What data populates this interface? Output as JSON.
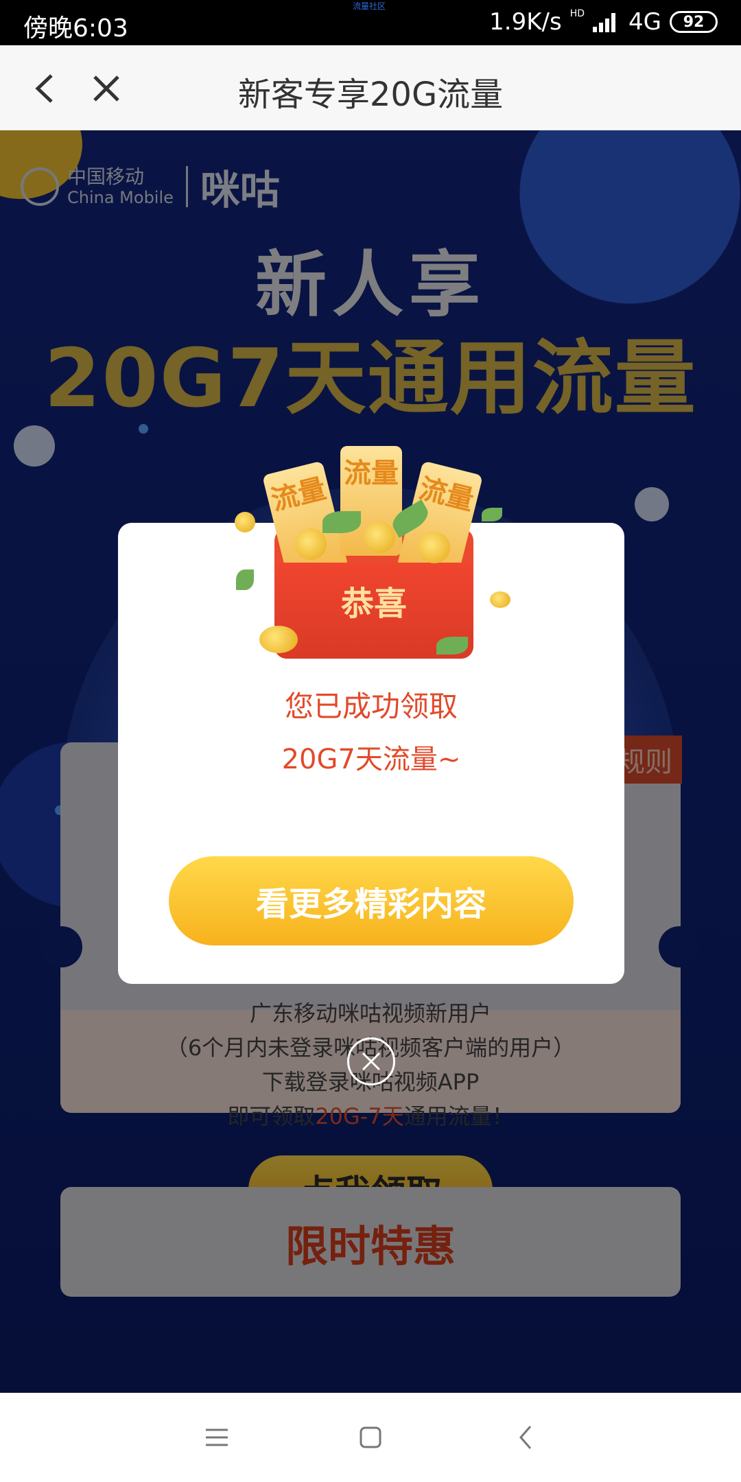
{
  "status_bar": {
    "time": "傍晚6:03",
    "speed": "1.9K/s",
    "network": "4G",
    "battery": "92",
    "hd": "HD"
  },
  "watermark": "流量社区",
  "header": {
    "title": "新客专享20G流量"
  },
  "page": {
    "logo": {
      "cn": "中国移动",
      "en": "China Mobile",
      "brand": "咪咕"
    },
    "hero": {
      "line1": "新人享",
      "line2": "20G7天通用流量"
    },
    "card": {
      "tag": "规则",
      "lines": [
        "广东移动咪咕视频新用户",
        "（6个月内未登录咪咕视频客户端的用户）",
        "下载登录咪咕视频APP"
      ],
      "line4_prefix": "即可领取",
      "line4_highlight": "20G-7天",
      "line4_suffix": "通用流量！",
      "claim_button": "点我领取"
    },
    "card2": {
      "title": "限时特惠"
    }
  },
  "modal": {
    "envelope": {
      "label": "恭喜",
      "ticket_text": "流量"
    },
    "message_line1": "您已成功领取",
    "message_line2": "20G7天流量~",
    "button": "看更多精彩内容"
  },
  "nav": {
    "menu_icon": "menu-icon",
    "home_icon": "home-icon",
    "back_icon": "back-icon"
  },
  "colors": {
    "accent_red": "#e24a2a",
    "button_yellow": "#ffd84a",
    "bg_blue": "#0d1f6b"
  }
}
